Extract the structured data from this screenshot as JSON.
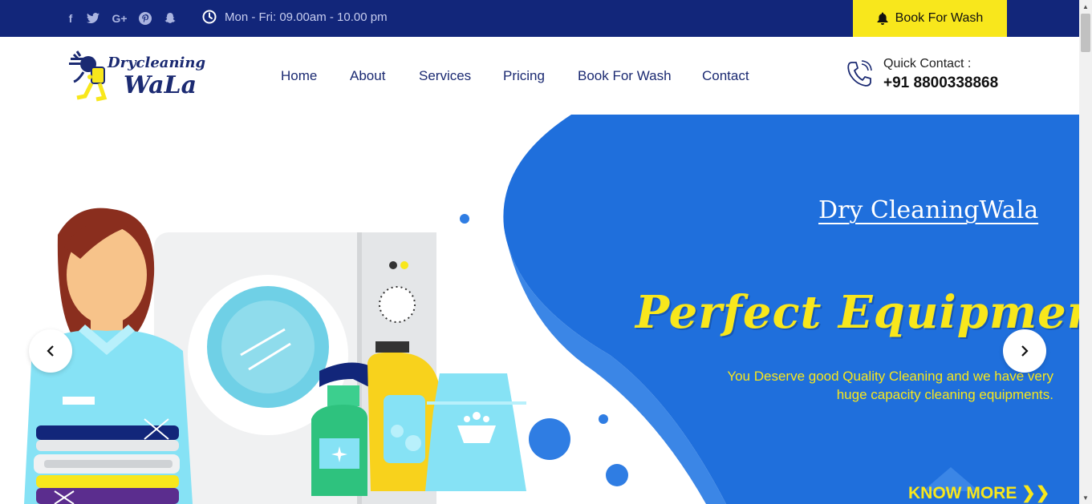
{
  "topbar": {
    "social": [
      {
        "name": "facebook",
        "glyph": "f"
      },
      {
        "name": "twitter",
        "glyph": "t"
      },
      {
        "name": "google-plus",
        "glyph": "G+"
      },
      {
        "name": "pinterest",
        "glyph": "P"
      },
      {
        "name": "snapchat",
        "glyph": "s"
      }
    ],
    "hours": "Mon - Fri: 09.00am - 10.00 pm",
    "book_label": "Book For Wash"
  },
  "header": {
    "logo_text_top": "Drycleaning",
    "logo_text_bottom": "WaLa",
    "nav": [
      {
        "label": "Home"
      },
      {
        "label": "About"
      },
      {
        "label": "Services"
      },
      {
        "label": "Pricing"
      },
      {
        "label": "Book For Wash"
      },
      {
        "label": "Contact"
      }
    ],
    "quick_contact_label": "Quick Contact :",
    "phone": "+91 8800338868"
  },
  "hero": {
    "brand": "Dry CleaningWala",
    "title": "Perfect Equipment",
    "description": "You Deserve good Quality Cleaning and we have very huge capacity cleaning equipments.",
    "cta": "KNOW MORE ❯❯"
  },
  "colors": {
    "topbar": "#12267a",
    "accent_yellow": "#f8e71c",
    "hero_blue": "#1f6fdc",
    "nav_text": "#1b2a72"
  }
}
